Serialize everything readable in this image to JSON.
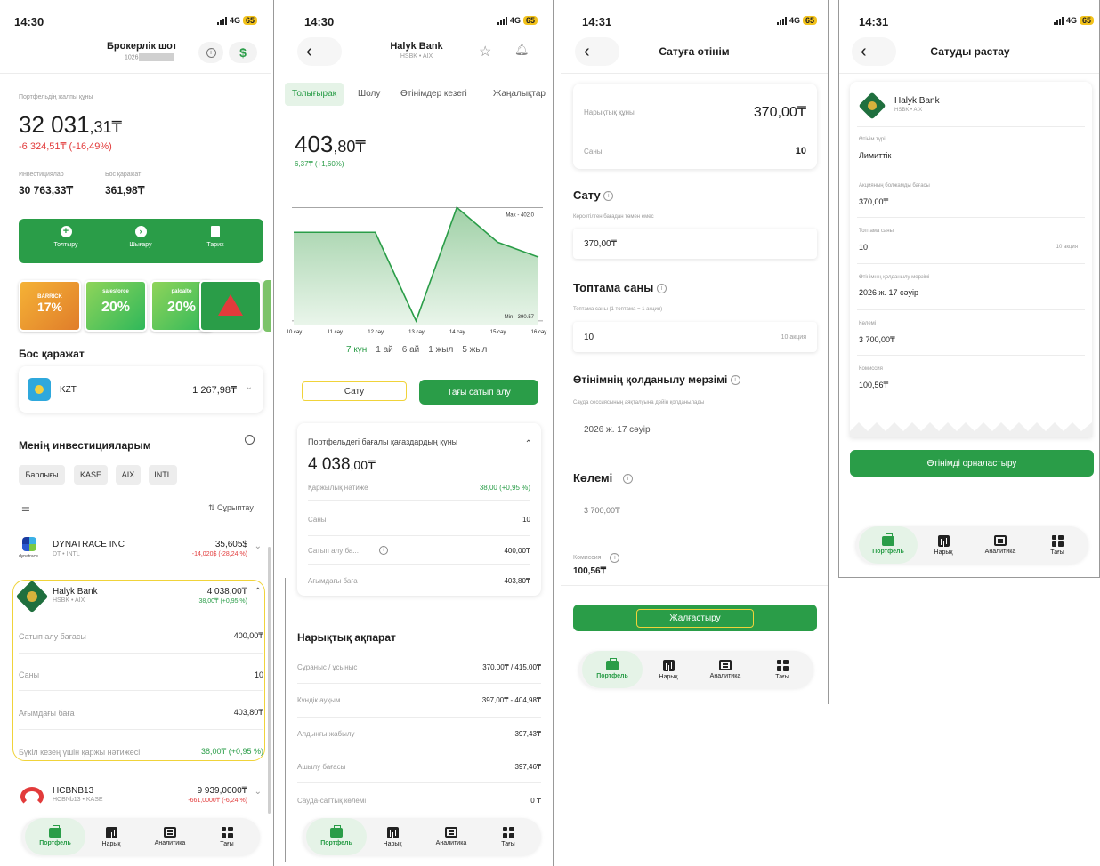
{
  "status": {
    "time1": "14:30",
    "time2": "14:30",
    "time3": "14:31",
    "time4": "14:31",
    "net": "4G",
    "battery": "65"
  },
  "screen1": {
    "title": "Брокерлік шот",
    "account": "1026",
    "portfolio_label": "Портфельдің жалпы құны",
    "total_main": "32 031",
    "total_dec": ",31₸",
    "change": "-6 324,51₸ (-16,49%)",
    "invest_label": "Инвестициялар",
    "invest_value": "30 763,33₸",
    "free_label": "Бос қаражат",
    "free_value": "361,98₸",
    "actions": [
      "Толтыру",
      "Шығару",
      "Тарих"
    ],
    "promos": [
      {
        "big": "17%",
        "brand": "BARRICK"
      },
      {
        "big": "20%",
        "brand": "salesforce"
      },
      {
        "big": "20%",
        "brand": "paloalto"
      }
    ],
    "free_section": "Бос қаражат",
    "currency": "KZT",
    "currency_amount": "1 267,98₸",
    "my_inv": "Менің инвестицияларым",
    "filters": [
      "Барлығы",
      "KASE",
      "AIX",
      "INTL"
    ],
    "sort": "Сұрыптау",
    "dyn": {
      "name": "DYNATRACE INC",
      "sub": "DT • INTL",
      "price": "35,605$",
      "chg": "-14,020$ (-28,24 %)",
      "logo_text": "dynatrace"
    },
    "halyk": {
      "name": "Halyk Bank",
      "sub": "HSBK • AIX",
      "price": "4 038,00₸",
      "chg": "38,00₸ (+0,95 %)"
    },
    "details": [
      {
        "k": "Сатып алу бағасы",
        "v": "400,00₸"
      },
      {
        "k": "Саны",
        "v": "10"
      },
      {
        "k": "Ағымдағы баға",
        "v": "403,80₸"
      },
      {
        "k": "Бүкіл кезең үшін қаржы нәтижесі",
        "v": "38,00₸ (+0,95 %)"
      }
    ],
    "hcb": {
      "name": "HCBNB13",
      "sub": "HCBNb13 • KASE",
      "price": "9 939,0000₸",
      "chg": "-661,0000₸ (-6,24 %)"
    }
  },
  "tabbar": [
    "Портфель",
    "Нарық",
    "Аналитика",
    "Тағы"
  ],
  "screen2": {
    "title": "Halyk Bank",
    "sub": "HSBK • AIX",
    "tabs": [
      "Толығырақ",
      "Шолу",
      "Өтінімдер кезегі",
      "Жаңалықтар"
    ],
    "price_main": "403",
    "price_dec": ",80₸",
    "price_chg": "6,37₸ (+1,60%)",
    "max_label": "Max - 402.0",
    "min_label": "Min - 390.57",
    "periods": [
      "7 күн",
      "1 ай",
      "6 ай",
      "1 жыл",
      "5 жыл"
    ],
    "sell": "Сату",
    "buy_more": "Тағы сатып алу",
    "pf_title": "Портфельдегі бағалы қағаздардың құны",
    "pf_main": "4 038",
    ",pf_dec": ",00₸",
    "pf_dec2": ",00₸",
    "pf_rows": [
      {
        "k": "Қаржылық нәтиже",
        "v": "38,00 (+0,95 %)"
      },
      {
        "k": "Саны",
        "v": "10"
      },
      {
        "k": "Сатып алу ба...",
        "v": "400,00₸"
      },
      {
        "k": "Ағымдағы баға",
        "v": "403,80₸"
      }
    ],
    "market_title": "Нарықтық ақпарат",
    "market_rows": [
      {
        "k": "Сұраныс / ұсыныс",
        "v": "370,00₸ / 415,00₸"
      },
      {
        "k": "Күндік ауқым",
        "v": "397,00₸ - 404,98₸"
      },
      {
        "k": "Алдыңғы жабылу",
        "v": "397,43₸"
      },
      {
        "k": "Ашылу бағасы",
        "v": "397,46₸"
      },
      {
        "k": "Сауда-саттық көлемі",
        "v": "0 ₸"
      }
    ]
  },
  "chart_data": {
    "type": "area",
    "x": [
      "10 сәу.",
      "11 сәу.",
      "12 сәу.",
      "13 сәу.",
      "14 сәу.",
      "15 сәу.",
      "16 сәу."
    ],
    "y": [
      399.5,
      399.5,
      399.5,
      390.57,
      402.0,
      398.5,
      397.0
    ],
    "max": 402.0,
    "min": 390.57
  },
  "screen3": {
    "title": "Сатуға өтінім",
    "market_price_label": "Нарықтық құны",
    "market_price": "370,00₸",
    "qty_label": "Саны",
    "qty": "10",
    "sell_label": "Сату",
    "sell_hint": "Көрсетілген бағадан төмен емес",
    "sell_value": "370,00₸",
    "lot_label": "Топтама саны",
    "lot_hint": "Топтама саны (1 топтама = 1 акция)",
    "lot_value": "10",
    "lot_unit": "10 акция",
    "valid_label": "Өтінімнің қолданылу мерзімі",
    "valid_hint": "Сауда сессиясының аяқталуына дейін қолданылады",
    "valid_value": "2026 ж. 17 сәуір",
    "volume_label": "Көлемі",
    "volume_value": "3 700,00₸",
    "commission_label": "Комиссия",
    "commission_value": "100,56₸",
    "continue": "Жалғастыру"
  },
  "screen4": {
    "title": "Сатуды растау",
    "bank": "Halyk Bank",
    "sub": "HSBK • AIX",
    "rows": [
      {
        "k": "Өтінім түрі",
        "v": "Лимиттік"
      },
      {
        "k": "Акцияның болжамды бағасы",
        "v": "370,00₸"
      },
      {
        "k": "Топтама саны",
        "v": "10",
        "extra": "10 акция"
      },
      {
        "k": "Өтінімнің қолданылу мерзімі",
        "v": "2026 ж. 17 сәуір"
      },
      {
        "k": "Көлемі",
        "v": "3 700,00₸"
      },
      {
        "k": "Комиссия",
        "v": "100,56₸"
      }
    ],
    "place": "Өтінімді орналастыру"
  },
  "colors": {
    "green": "#2a9d48",
    "red": "#e23b3b",
    "highlight": "#f0d33a"
  }
}
